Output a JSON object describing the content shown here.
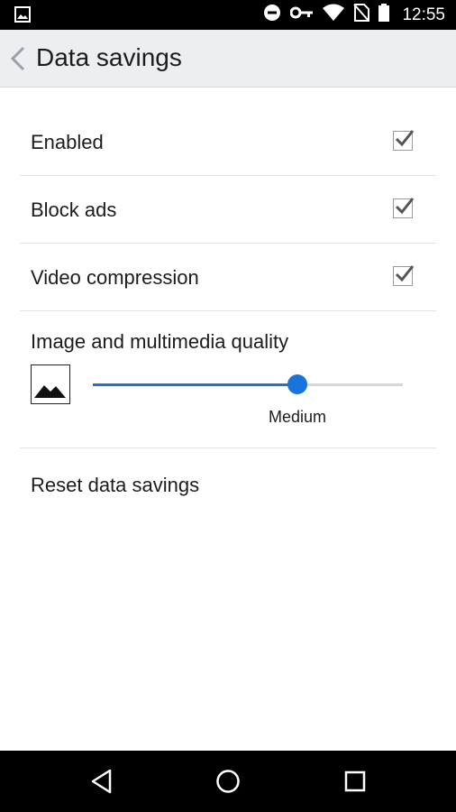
{
  "status_bar": {
    "time": "12:55",
    "icons": [
      "image-notification-icon",
      "do-not-disturb-icon",
      "vpn-key-icon",
      "wifi-icon",
      "no-sim-icon",
      "battery-icon"
    ]
  },
  "app_bar": {
    "title": "Data savings",
    "back_icon": "chevron-left-icon"
  },
  "settings": {
    "enabled": {
      "label": "Enabled",
      "checked": true
    },
    "block_ads": {
      "label": "Block ads",
      "checked": true
    },
    "video_compression": {
      "label": "Video compression",
      "checked": true
    },
    "image_quality": {
      "label": "Image and multimedia quality",
      "value_label": "Medium",
      "level_fraction": 0.66,
      "icon": "image-icon"
    },
    "reset": {
      "label": "Reset data savings"
    }
  },
  "nav_bar": {
    "back": "back-triangle-icon",
    "home": "home-circle-icon",
    "recents": "recents-square-icon"
  },
  "colors": {
    "accent": "#1a73d9",
    "app_bar_bg": "#eceef1",
    "status_bar_bg": "#000000"
  }
}
